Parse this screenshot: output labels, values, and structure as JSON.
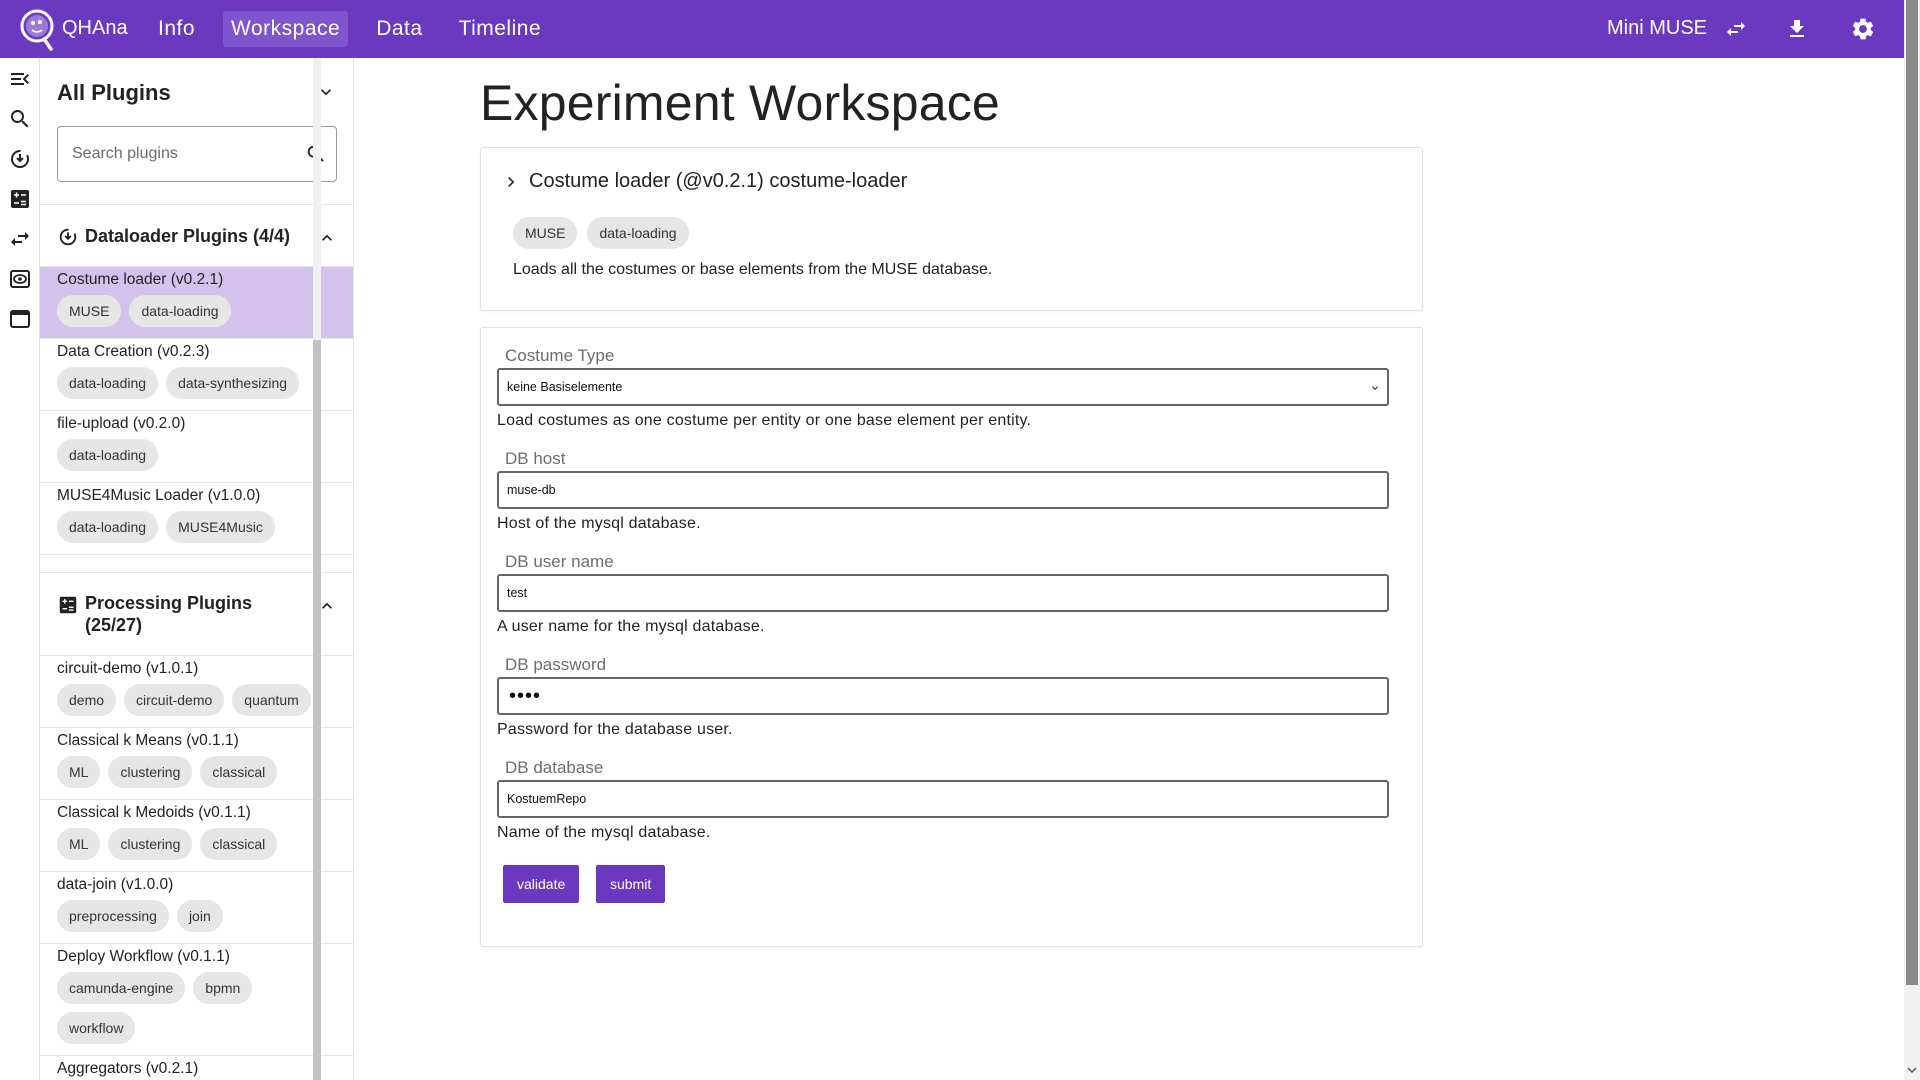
{
  "app": {
    "name": "QHAna",
    "nav": [
      "Info",
      "Workspace",
      "Data",
      "Timeline"
    ],
    "active_nav": "Workspace",
    "backend_name": "Mini MUSE"
  },
  "colors": {
    "primary": "#6a39bf",
    "selected_plugin": "#d2c2ec",
    "chip": "#e6e6e6"
  },
  "icons": {
    "rail": [
      "collapse-sidebar-icon",
      "search-icon",
      "dataloader-icon",
      "calculator-icon",
      "swap-icon",
      "eye-icon",
      "window-icon"
    ],
    "top": [
      "swap-icon",
      "download-icon",
      "gear-icon"
    ]
  },
  "sidebar": {
    "title": "All Plugins",
    "search_placeholder": "Search plugins",
    "groups": [
      {
        "title": "Dataloader Plugins (4/4)",
        "plugins": [
          {
            "name": "Costume loader (v0.2.1)",
            "tags": [
              "MUSE",
              "data-loading"
            ]
          },
          {
            "name": "Data Creation (v0.2.3)",
            "tags": [
              "data-loading",
              "data-synthesizing"
            ]
          },
          {
            "name": "file-upload (v0.2.0)",
            "tags": [
              "data-loading"
            ]
          },
          {
            "name": "MUSE4Music Loader (v1.0.0)",
            "tags": [
              "data-loading",
              "MUSE4Music"
            ]
          }
        ]
      },
      {
        "title_line1": "Processing Plugins",
        "title_line2": "(25/27)",
        "plugins": [
          {
            "name": "circuit-demo (v1.0.1)",
            "tags": [
              "demo",
              "circuit-demo",
              "quantum"
            ]
          },
          {
            "name": "Classical k Means (v0.1.1)",
            "tags": [
              "ML",
              "clustering",
              "classical"
            ]
          },
          {
            "name": "Classical k Medoids (v0.1.1)",
            "tags": [
              "ML",
              "clustering",
              "classical"
            ]
          },
          {
            "name": "data-join (v1.0.0)",
            "tags": [
              "preprocessing",
              "join"
            ]
          },
          {
            "name": "Deploy Workflow (v0.1.1)",
            "tags": [
              "camunda-engine",
              "bpmn",
              "workflow"
            ]
          },
          {
            "name": "Aggregators (v0.2.1)",
            "tags": []
          }
        ]
      }
    ]
  },
  "main": {
    "title": "Experiment Workspace",
    "plugin_card": {
      "title": "Costume loader (@v0.2.1) costume-loader",
      "tags": [
        "MUSE",
        "data-loading"
      ],
      "description": "Loads all the costumes or base elements from the MUSE database."
    },
    "form": {
      "costume_type": {
        "label": "Costume Type",
        "value": "keine Basiselemente",
        "help": "Load costumes as one costume per entity or one base element per entity."
      },
      "db_host": {
        "label": "DB host",
        "value": "muse-db",
        "help": "Host of the mysql database."
      },
      "db_user": {
        "label": "DB user name",
        "value": "test",
        "help": "A user name for the mysql database."
      },
      "db_password": {
        "label": "DB password",
        "value": "••••",
        "help": "Password for the database user."
      },
      "db_database": {
        "label": "DB database",
        "value": "KostuemRepo",
        "help": "Name of the mysql database."
      },
      "validate_label": "validate",
      "submit_label": "submit"
    }
  }
}
